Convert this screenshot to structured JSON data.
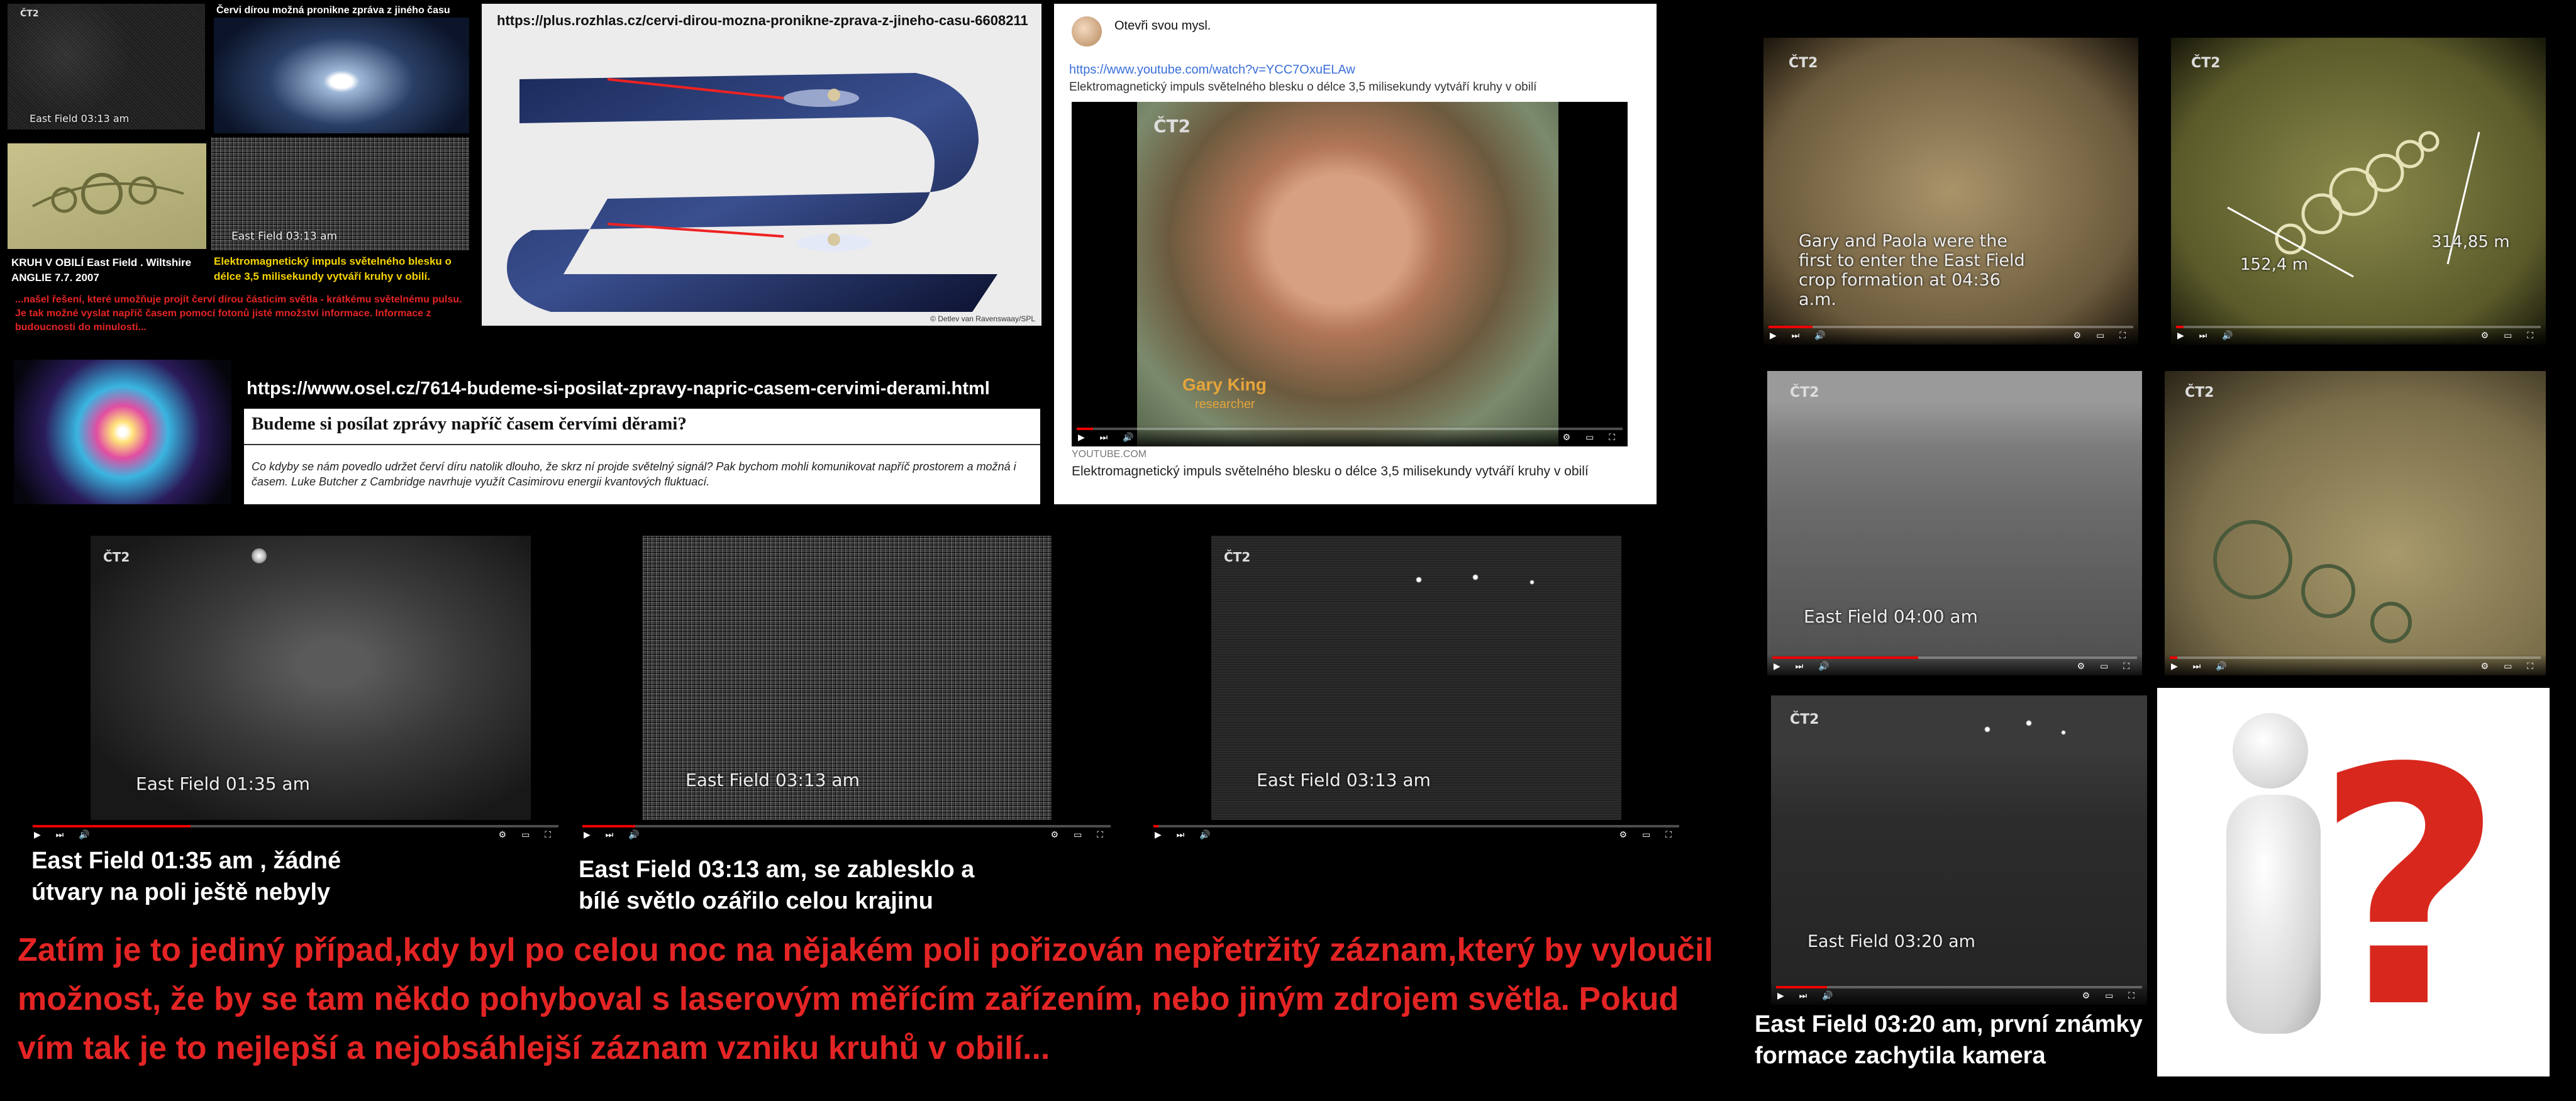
{
  "thumbs": {
    "tl_label": "East Field 03:13 am",
    "tl2_label": "East Field 03:13 am",
    "wormhole_title": "Červi dírou možná pronikne zpráva z jiného času",
    "cropcircle_caption": "KRUH V OBILÍ East Field . Wiltshire ANGLIE 7.7. 2007",
    "impulse_caption": "Elektromagnetický impuls světelného blesku o délce 3,5 milisekundy vytváří kruhy v obilí.",
    "red_note": "...našel řešení, které umožňuje projít červí dírou částicím světla - krátkému světelnému pulsu. Je tak možné vyslat napříč časem pomocí fotonů jisté množství informace. Informace z budoucnosti do minulosti..."
  },
  "rozhlas": {
    "url": "https://plus.rozhlas.cz/cervi-dirou-mozna-pronikne-zprava-z-jineho-casu-6608211",
    "credit": "© Detlev van Ravenswaay/SPL"
  },
  "osel": {
    "url": "https://www.osel.cz/7614-budeme-si-posilat-zpravy-napric-casem-cervimi-derami.html",
    "title": "Budeme si posílat zprávy napříč časem červími děrami?",
    "text": "Co kdyby se nám povedlo udržet červí díru natolik dlouho, že skrz ní projde světelný signál? Pak bychom mohli komunikovat napříč prostorem a možná i časem. Luke Butcher z Cambridge navrhuje využít Casimirovu energii kvantových fluktuací."
  },
  "fb_post": {
    "author_line": "Otevři svou mysl.",
    "link": "https://www.youtube.com/watch?v=YCC7OxuELAw",
    "desc": "Elektromagnetický impuls světelného blesku o délce 3,5 milisekundy vytváří kruhy v obilí",
    "name_tag": "Gary King",
    "role_tag": "researcher",
    "domain": "YOUTUBE.COM",
    "footer_title": "Elektromagnetický impuls světelného blesku o délce 3,5 milisekundy vytváří kruhy v obilí"
  },
  "videos": {
    "v1_label": "East Field 01:35 am",
    "v2_label": "East Field 03:13 am",
    "v3_label": "East Field 03:13 am",
    "r1_text": "Gary and Paola were the first to enter the East Field crop formation at 04:36 a.m.",
    "r2_m1": "152,4 m",
    "r2_m2": "314,85 m",
    "r3_label": "East Field 04:00 am",
    "r5_label": "East Field 03:20 am",
    "logo": "ČT2"
  },
  "captions": {
    "c1": "East Field 01:35 am , žádné útvary na poli ještě nebyly",
    "c2": "East Field 03:13 am, se zablesklo a bílé světlo ozářilo celou krajinu",
    "c3": "East Field 03:20 am, první známky formace zachytila kamera",
    "main": "Zatím je to jediný případ,kdy byl po celou noc na nějakém poli pořizován nepřetržitý záznam,který by vyloučil možnost, že by se tam někdo pohyboval s laserovým měřícím zařízením, nebo jiným zdrojem světla. Pokud vím tak je to nejlepší a nejobsáhlejší záznam vzniku kruhů v obilí..."
  },
  "question_mark": "?",
  "colors": {
    "red": "#e42424",
    "yellow": "#f5d400",
    "link": "#3b6fd9"
  }
}
